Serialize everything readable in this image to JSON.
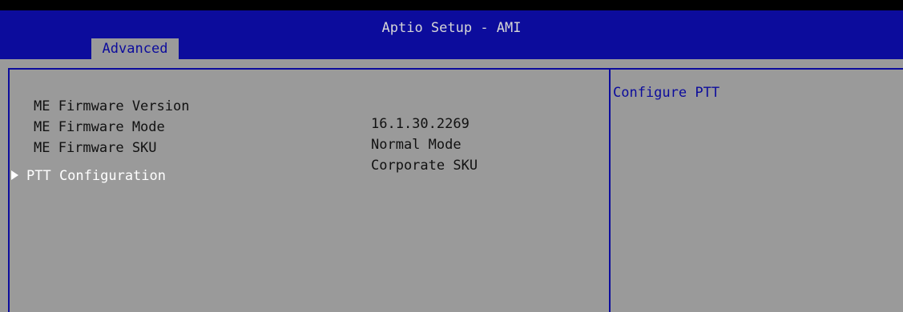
{
  "header": {
    "title": "Aptio Setup - AMI",
    "active_tab": "Advanced"
  },
  "info": [
    {
      "label": "ME Firmware Version",
      "value": "16.1.30.2269"
    },
    {
      "label": "ME Firmware Mode",
      "value": "Normal Mode"
    },
    {
      "label": "ME Firmware SKU",
      "value": "Corporate SKU"
    }
  ],
  "menu": {
    "submenu_label": "PTT Configuration"
  },
  "help": {
    "text": "Configure PTT"
  },
  "colors": {
    "header_bg": "#0c0c9c",
    "panel_bg": "#9a9a9a",
    "selected_text": "#ffffff",
    "help_text": "#0c0c9c"
  }
}
